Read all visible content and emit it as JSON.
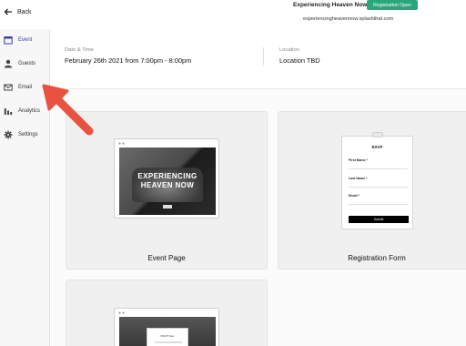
{
  "topbar": {
    "back_label": "Back",
    "event_title": "Experiencing Heaven Now",
    "status_badge": "Registration Open",
    "event_url": "experiencingheavennow.splashthat.com"
  },
  "sidebar": {
    "items": [
      {
        "label": "Event",
        "icon": "calendar-icon",
        "active": true
      },
      {
        "label": "Guests",
        "icon": "person-icon",
        "active": false
      },
      {
        "label": "Email",
        "icon": "envelope-icon",
        "active": false
      },
      {
        "label": "Analytics",
        "icon": "bar-chart-icon",
        "active": false
      },
      {
        "label": "Settings",
        "icon": "gear-icon",
        "active": false
      }
    ]
  },
  "info": {
    "date_label": "Date & Time",
    "date_value": "February 26th 2021 from 7:00pm - 8:00pm",
    "location_label": "Location",
    "location_value": "Location TBD"
  },
  "cards": {
    "event_page": {
      "label": "Event Page",
      "hero_title_line1": "EXPERIENCING",
      "hero_title_line2": "HEAVEN NOW"
    },
    "registration_form": {
      "label": "Registration Form",
      "heading": "RSVP",
      "fields": [
        {
          "label": "First Name *"
        },
        {
          "label": "Last Name *"
        },
        {
          "label": "Email *"
        }
      ],
      "submit_label": "Submit"
    },
    "third": {
      "title": "RSVP Now"
    }
  },
  "colors": {
    "accent": "#3a3fa0",
    "badge": "#2aa779",
    "arrow": "#e8523f"
  }
}
